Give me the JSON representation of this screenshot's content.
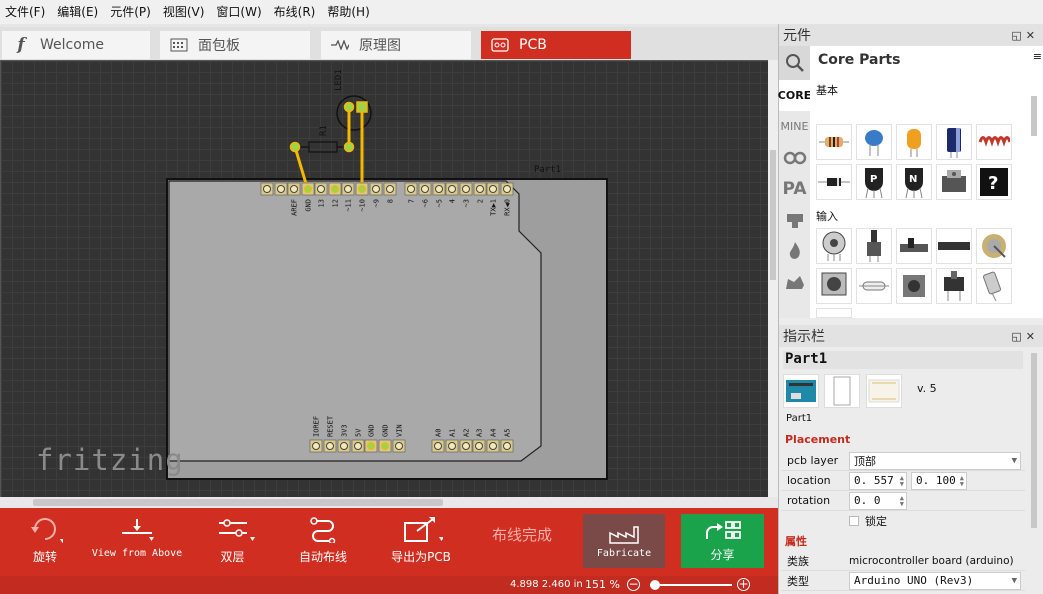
{
  "menu": [
    "文件(F)",
    "编辑(E)",
    "元件(P)",
    "视图(V)",
    "窗口(W)",
    "布线(R)",
    "帮助(H)"
  ],
  "tabs": [
    {
      "label": "Welcome",
      "icon": "fritzing-f-icon"
    },
    {
      "label": "面包板",
      "icon": "breadboard-icon"
    },
    {
      "label": "原理图",
      "icon": "schematic-icon"
    },
    {
      "label": "PCB",
      "icon": "pcb-icon"
    }
  ],
  "canvas": {
    "watermark": "fritzing",
    "part_label": "Part1",
    "led_label": "LED1",
    "resistor_label": "R1",
    "top_header_labels": [
      "AREF",
      "GND",
      "13",
      "12",
      "~11",
      "~10",
      "~9",
      "8",
      "7",
      "~6",
      "~5",
      "4",
      "~3",
      "2",
      "TX▶1",
      "RX◀0"
    ],
    "bottom_header_labels": [
      "IOREF",
      "RESET",
      "3V3",
      "5V",
      "GND",
      "GND",
      "VIN",
      "A0",
      "A1",
      "A2",
      "A3",
      "A4",
      "A5"
    ]
  },
  "toolbar": {
    "rotate": "旋转",
    "view": "View from Above",
    "layers": "双层",
    "autoroute": "自动布线",
    "export": "导出为PCB",
    "routing_status": "布线完成",
    "fabricate": "Fabricate",
    "share": "分享"
  },
  "status": {
    "coords": "4.898 2.460 in",
    "zoom": "151 %"
  },
  "parts_panel": {
    "title": "元件",
    "bin_title": "Core Parts",
    "side_tabs": [
      "CORE",
      "MINE"
    ],
    "section_basic": "基本",
    "section_input": "输入"
  },
  "inspector": {
    "title": "指示栏",
    "part_name": "Part1",
    "version": "v. 5",
    "caption": "Part1",
    "placement_title": "Placement",
    "pcb_layer_label": "pcb layer",
    "pcb_layer_value": "顶部",
    "location_label": "location",
    "location_x": "0. 557",
    "location_y": "0. 100",
    "rotation_label": "rotation",
    "rotation_value": "0. 0",
    "locked_label": "锁定",
    "properties_title": "属性",
    "family_label": "类族",
    "family_value": "microcontroller board (arduino)",
    "type_label": "类型",
    "type_value": "Arduino UNO (Rev3)"
  },
  "colors": {
    "accent": "#d12e22",
    "trace": "#f5b800",
    "share": "#1aa34a",
    "fabricate": "#7a4a48"
  }
}
